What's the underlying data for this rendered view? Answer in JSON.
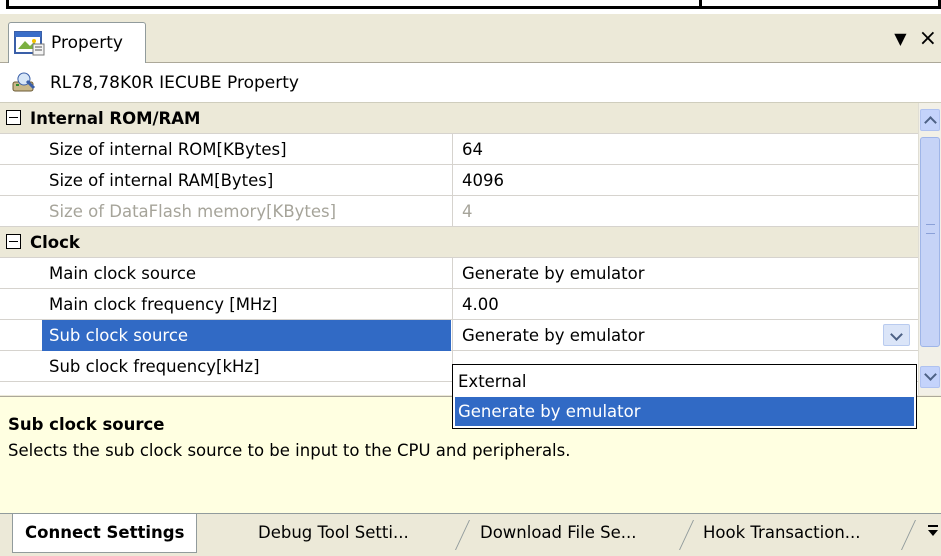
{
  "panel": {
    "tab_label": "Property",
    "title": "RL78,78K0R IECUBE Property",
    "header_buttons": {
      "menu": "▼",
      "close": "×"
    }
  },
  "grid": {
    "categories": [
      {
        "label": "Internal ROM/RAM"
      },
      {
        "label": "Clock"
      }
    ],
    "rows": [
      {
        "name": "Size of internal ROM[KBytes]",
        "value": "64"
      },
      {
        "name": "Size of internal RAM[Bytes]",
        "value": "4096"
      },
      {
        "name": "Size of DataFlash memory[KBytes]",
        "value": "4"
      },
      {
        "name": "Main clock source",
        "value": "Generate by emulator"
      },
      {
        "name": "Main clock frequency [MHz]",
        "value": "4.00"
      },
      {
        "name": "Sub clock source",
        "value": "Generate by emulator"
      },
      {
        "name": "Sub clock frequency[kHz]",
        "value": ""
      }
    ]
  },
  "dropdown": {
    "options": [
      "External",
      "Generate by emulator"
    ],
    "selected": "Generate by emulator"
  },
  "description": {
    "title": "Sub clock source",
    "text": "Selects the sub clock source to be input to the CPU and peripherals."
  },
  "bottom_tabs": [
    {
      "label": "Connect Settings"
    },
    {
      "label": "Debug Tool Setti..."
    },
    {
      "label": "Download File Se..."
    },
    {
      "label": "Hook Transaction..."
    }
  ],
  "icons": [
    "property-window-icon",
    "emulator-icon",
    "menu-arrow-icon",
    "close-icon",
    "tab-list-icon"
  ],
  "colors": {
    "selection": "#316ac5",
    "panel_bg": "#ece9d8",
    "description_bg": "#ffffe1",
    "disabled_text": "#a6a49a"
  }
}
